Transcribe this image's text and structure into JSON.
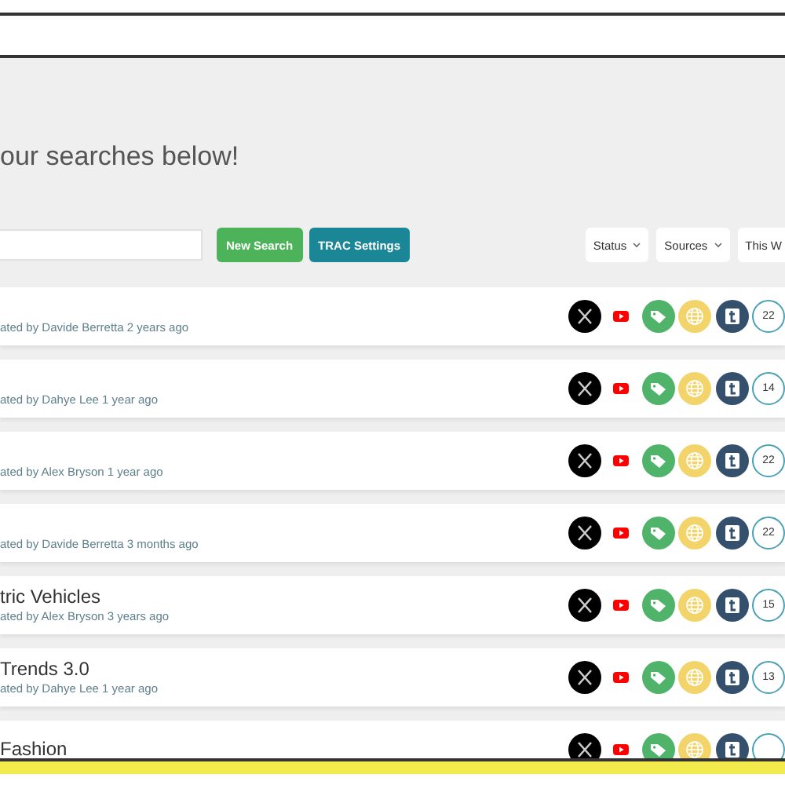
{
  "heading": "our searches below!",
  "buttons": [
    {
      "label": "New Search",
      "kind": "primary"
    },
    {
      "label": "TRAC Settings",
      "kind": "secondary"
    }
  ],
  "filters": [
    {
      "label": "Status",
      "caret": true
    },
    {
      "label": "Sources",
      "caret": true
    },
    {
      "label": "This W",
      "caret": false
    }
  ],
  "rows": [
    {
      "subtitle": "ated by Davide Berretta 2 years ago",
      "count": "22"
    },
    {
      "subtitle": "ated by Dahye Lee 1 year ago",
      "count": "14"
    },
    {
      "subtitle": "ated by Alex Bryson 1 year ago",
      "count": "22"
    },
    {
      "subtitle": "ated by Davide Berretta 3 months ago",
      "count": "22"
    },
    {
      "title": "tric Vehicles",
      "subtitle": "ated by Alex Bryson 3 years ago",
      "count": "15"
    },
    {
      "title": "Trends 3.0",
      "subtitle": "ated by Dahye Lee 1 year ago",
      "count": "13"
    },
    {
      "title": "Fashion"
    }
  ]
}
